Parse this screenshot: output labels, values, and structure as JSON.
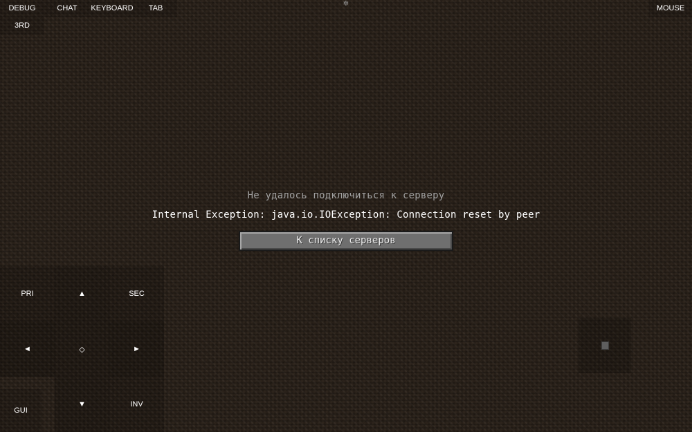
{
  "top_bar": {
    "debug": "DEBUG",
    "chat": "CHAT",
    "keyboard": "KEYBOARD",
    "tab": "TAB",
    "third_person": "3RD",
    "mouse": "MOUSE"
  },
  "settings_icon": "gear-icon",
  "disconnect": {
    "title": "Не удалось подключиться к серверу",
    "reason": "Internal Exception: java.io.IOException: Connection reset by peer",
    "back_button": "К списку серверов"
  },
  "dpad": {
    "primary": "PRI",
    "up": "▲",
    "secondary": "SEC",
    "left": "◄",
    "center": "◇",
    "right": "►",
    "gui": "GUI",
    "down": "▼",
    "inventory": "INV"
  },
  "colors": {
    "background": "#2d241c",
    "button_face": "#6f6f6f",
    "title_text": "#a0a0a0",
    "text": "#ffffff"
  }
}
